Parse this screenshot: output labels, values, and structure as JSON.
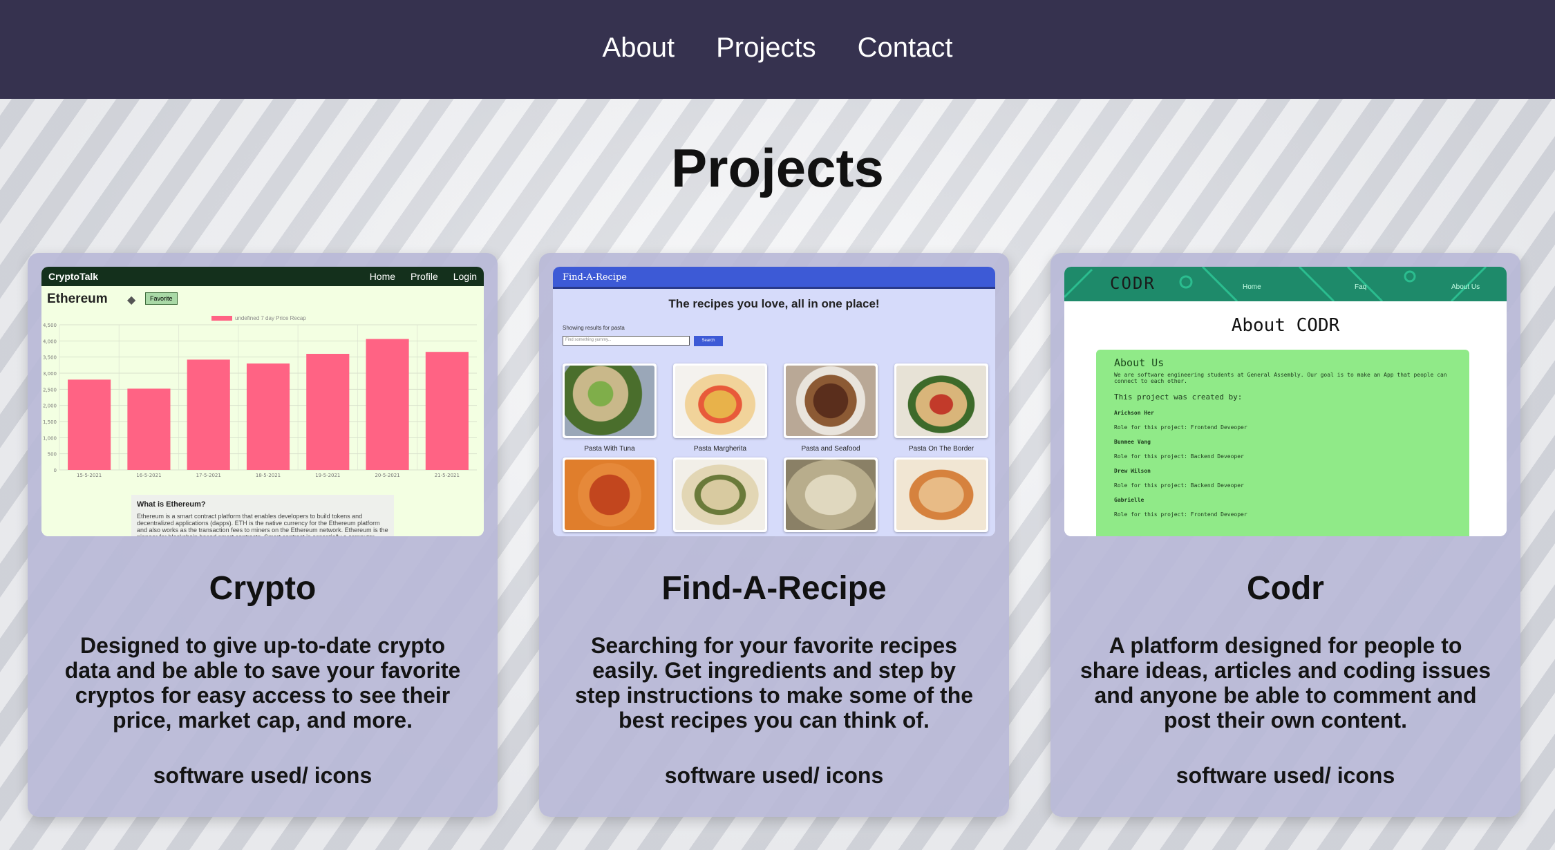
{
  "nav": {
    "items": [
      "About",
      "Projects",
      "Contact"
    ]
  },
  "page": {
    "title": "Projects"
  },
  "projects": [
    {
      "title": "Crypto",
      "description": "Designed to give up-to-date crypto data and be able to save your favorite cryptos for easy access to see their price, market cap, and more.",
      "software": "software used/ icons",
      "preview": {
        "brand": "CryptoTalk",
        "links": [
          "Home",
          "Profile",
          "Login"
        ],
        "coin": "Ethereum",
        "favorite_btn": "Favorite",
        "legend": "undefined 7 day Price Recap",
        "info_title": "What is Ethereum?",
        "info_text": "Ethereum is a smart contract platform that enables developers to build tokens and decentralized applications (dapps). ETH is the native currency for the Ethereum platform and also works as the transaction fees to miners on the Ethereum network. Ethereum is the pioneer for blockchain based smart contracts. Smart contract is essentially a computer code that runs exactly as programmed",
        "chart_data": {
          "type": "bar",
          "title": "",
          "series": [
            {
              "name": "undefined 7 day Price Recap",
              "values": [
                2800,
                2520,
                3420,
                3300,
                3600,
                4060,
                3660
              ]
            }
          ],
          "categories": [
            "15-5-2021",
            "16-5-2021",
            "17-5-2021",
            "18-5-2021",
            "19-5-2021",
            "20-5-2021",
            "21-5-2021"
          ],
          "yticks": [
            "4,500",
            "4,000",
            "3,500",
            "3,000",
            "2,500",
            "2,000",
            "1,500",
            "1,000",
            "500",
            "0"
          ],
          "ylim": [
            0,
            4500
          ],
          "color": "#ff6384",
          "grid": true
        }
      }
    },
    {
      "title": "Find-A-Recipe",
      "description": "Searching for your favorite recipes easily. Get ingredients and step by step instructions to make some of the best recipes you can think of.",
      "software": "software used/ icons",
      "preview": {
        "brand": "Find-A-Recipe",
        "tagline": "The recipes you love, all in one place!",
        "showing": "Showing results for pasta",
        "search_placeholder": "Find something yummy...",
        "search_btn": "Search",
        "recipes": [
          "Pasta With Tuna",
          "Pasta Margherita",
          "Pasta and Seafood",
          "Pasta On The Border"
        ]
      }
    },
    {
      "title": "Codr",
      "description": "A platform designed for people to share ideas, articles and coding issues and anyone be able to comment and post their own content.",
      "software": "software used/ icons",
      "preview": {
        "brand": "CODR",
        "links": [
          "Home",
          "Faq",
          "About Us"
        ],
        "heading": "About CODR",
        "about_title": "About Us",
        "about_text": "We are software engineering students at General Assembly. Our goal is to make an App that people can connect to each other.",
        "created_by": "This project was created by:",
        "people": [
          {
            "name": "Arichson Her",
            "role": "Role for this project: Frontend Deveoper"
          },
          {
            "name": "Bunmee Vang",
            "role": "Role for this project: Backend Deveoper"
          },
          {
            "name": "Drew Wilson",
            "role": "Role for this project: Backend Deveoper"
          },
          {
            "name": "Gabrielle",
            "role": "Role for this project: Frontend Deveoper"
          }
        ]
      }
    }
  ]
}
